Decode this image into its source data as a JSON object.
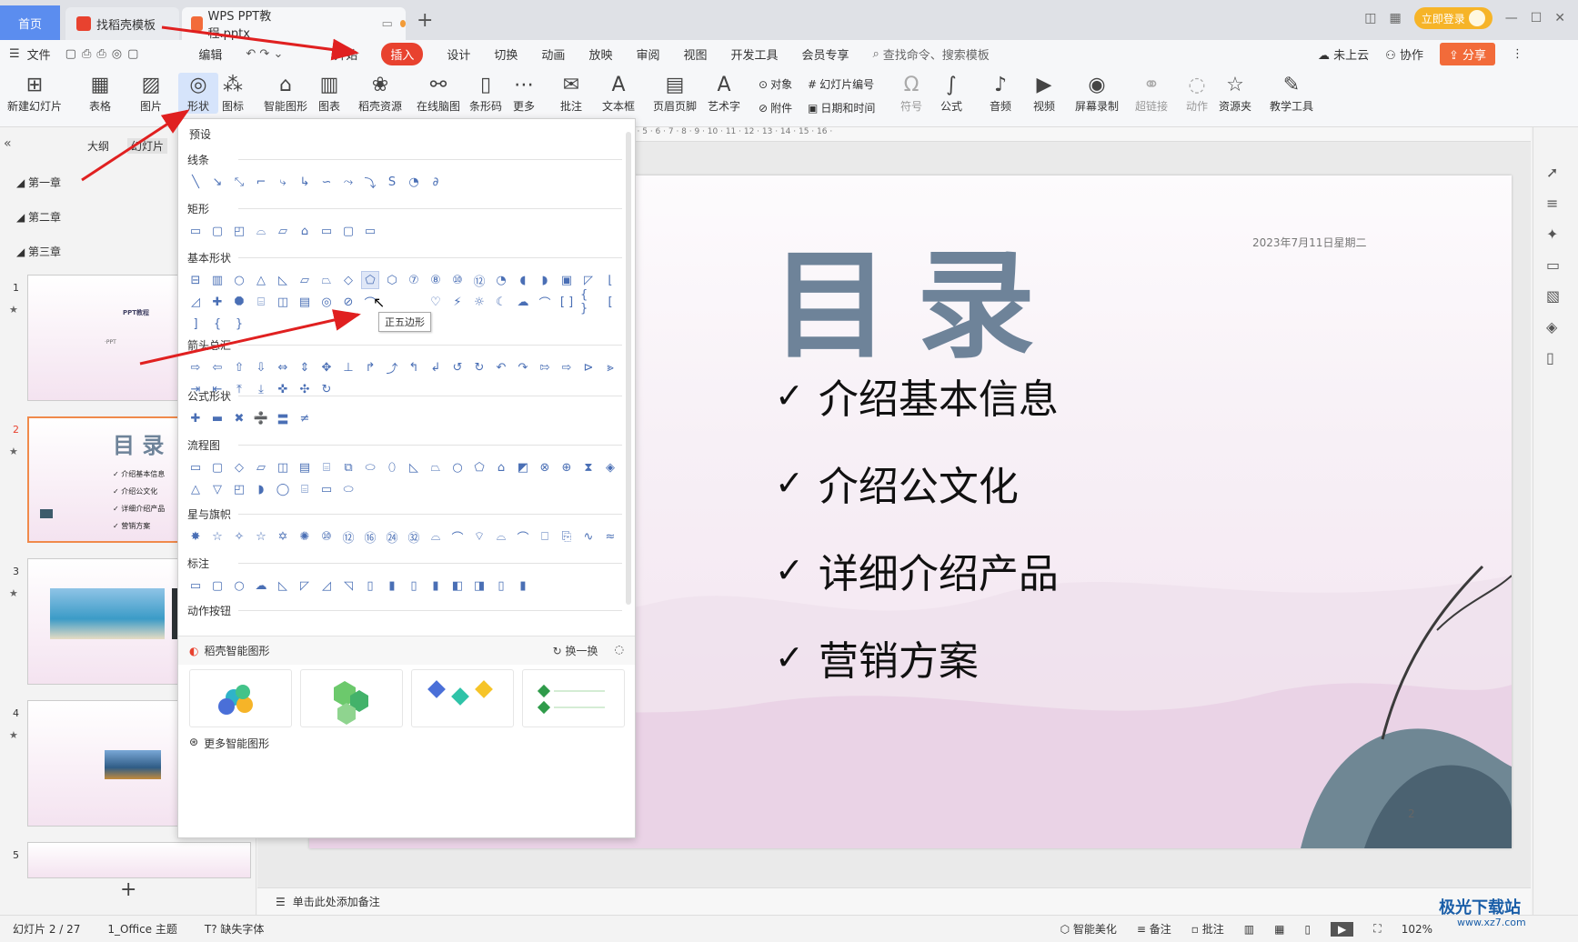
{
  "titlebar": {
    "home_tab": "首页",
    "tabs": [
      {
        "label": "找稻壳模板",
        "icon": "daoke-icon",
        "color": "#e8422f"
      },
      {
        "label": "WPS PPT教程.pptx",
        "icon": "ppt-icon",
        "color": "#f26b3a"
      }
    ],
    "login_label": "立即登录"
  },
  "menubar": {
    "file": "文件",
    "items": [
      "编辑",
      "开始",
      "插入",
      "设计",
      "切换",
      "动画",
      "放映",
      "审阅",
      "视图",
      "开发工具",
      "会员专享"
    ],
    "active": "插入",
    "search_placeholder": "查找命令、搜索模板",
    "cloud": "未上云",
    "collab": "协作",
    "share": "分享"
  },
  "toolbar": {
    "buttons": [
      "新建幻灯片",
      "表格",
      "图片",
      "形状",
      "图标",
      "智能图形",
      "图表",
      "稻壳资源",
      "在线脑图",
      "条形码",
      "更多",
      "批注",
      "文本框",
      "页眉页脚",
      "艺术字"
    ],
    "small": [
      "对象",
      "附件",
      "幻灯片编号",
      "日期和时间"
    ],
    "buttons2": [
      "符号",
      "公式",
      "音频",
      "视频",
      "屏幕录制",
      "超链接",
      "动作",
      "资源夹",
      "教学工具"
    ]
  },
  "left_panel": {
    "tabs": [
      "大纲",
      "幻灯片"
    ],
    "chapters": [
      "第一章",
      "第二章",
      "第三章"
    ],
    "thumb_numbers": [
      "1",
      "2",
      "3",
      "4",
      "5"
    ],
    "thumb1": {
      "title": "PPT教程",
      "sub": "·PPT"
    },
    "thumb2": {
      "title": "目 录",
      "items": [
        "✓ 介绍基本信息",
        "✓ 介绍公文化",
        "✓ 详细介绍产品",
        "✓ 营销方案"
      ]
    }
  },
  "shapes_menu": {
    "preset": "预设",
    "sections": [
      "线条",
      "矩形",
      "基本形状",
      "箭头总汇",
      "公式形状",
      "流程图",
      "星与旗帜",
      "标注",
      "动作按钮"
    ],
    "tooltip": "正五边形",
    "smart_title": "稻壳智能图形",
    "swap": "换一换",
    "more": "更多智能图形"
  },
  "slide": {
    "title": "目录",
    "date": "2023年7月11日星期二",
    "bullets": [
      "介绍基本信息",
      "介绍公文化",
      "详细介绍产品",
      "营销方案"
    ],
    "page": "2"
  },
  "ruler_text": "· 15 · 14 · 13 · 12 · 11 · 10 · 9 · 8 · 7 · 6 · 5 · 4 · 3 · 2 · 1 · 0 · 1 · 2 · 3 · 4 · 5 · 6 · 7 · 8 · 9 · 10 · 11 · 12 · 13 · 14 · 15 · 16 ·",
  "notes": "单击此处添加备注",
  "status": {
    "slide": "幻灯片 2 / 27",
    "theme": "1_Office 主题",
    "font": "缺失字体",
    "beautify": "智能美化",
    "notes": "备注",
    "comments": "批注",
    "zoom": "102%"
  },
  "watermark": {
    "name": "极光下载站",
    "url": "www.xz7.com"
  },
  "colors": {
    "accent": "#e8422f",
    "home": "#5b8def",
    "title": "#6e8399",
    "shape": "#4a6fb5"
  }
}
